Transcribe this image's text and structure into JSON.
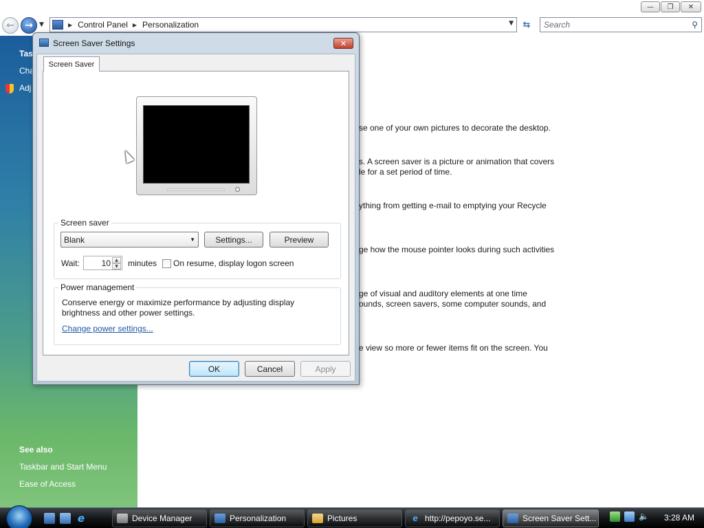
{
  "window": {
    "minimize": "—",
    "restore": "❐",
    "close": "✕"
  },
  "navbar": {
    "breadcrumbs": [
      "Control Panel",
      "Personalization"
    ],
    "search_placeholder": "Search"
  },
  "task_pane": {
    "heading": "Tas",
    "links": [
      "Cha",
      "Adj"
    ],
    "see_also": "See also",
    "see_also_links": [
      "Taskbar and Start Menu",
      "Ease of Access"
    ]
  },
  "main": {
    "lines": [
      "se one of your own pictures to decorate the desktop.",
      "s. A screen saver is a picture or animation that covers",
      "le for a set period of time.",
      "ything from getting e-mail to emptying your Recycle",
      "ge how the mouse pointer looks during such activities",
      "ge of visual and auditory elements at one time",
      "ounds, screen savers, some computer sounds, and",
      "e view so more or fewer items fit on the screen. You"
    ]
  },
  "dialog": {
    "title": "Screen Saver Settings",
    "close": "✕",
    "tab": "Screen Saver",
    "screen_saver": {
      "group_label": "Screen saver",
      "selected": "Blank",
      "settings_button": "Settings...",
      "preview_button": "Preview",
      "wait_label": "Wait:",
      "wait_value": "10",
      "minutes_label": "minutes",
      "logon_checked": false,
      "logon_label": "On resume, display logon screen"
    },
    "power": {
      "group_label": "Power management",
      "description": "Conserve energy or maximize performance by adjusting display brightness and other power settings.",
      "link": "Change power settings..."
    },
    "ok": "OK",
    "cancel": "Cancel",
    "apply": "Apply"
  },
  "taskbar": {
    "tasks": [
      "Device Manager",
      "Personalization",
      "Pictures",
      "http://pepoyo.se...",
      "Screen Saver Sett..."
    ],
    "ie_glyph": "e",
    "volume_glyph": "🔈",
    "clock": "3:28 AM"
  }
}
